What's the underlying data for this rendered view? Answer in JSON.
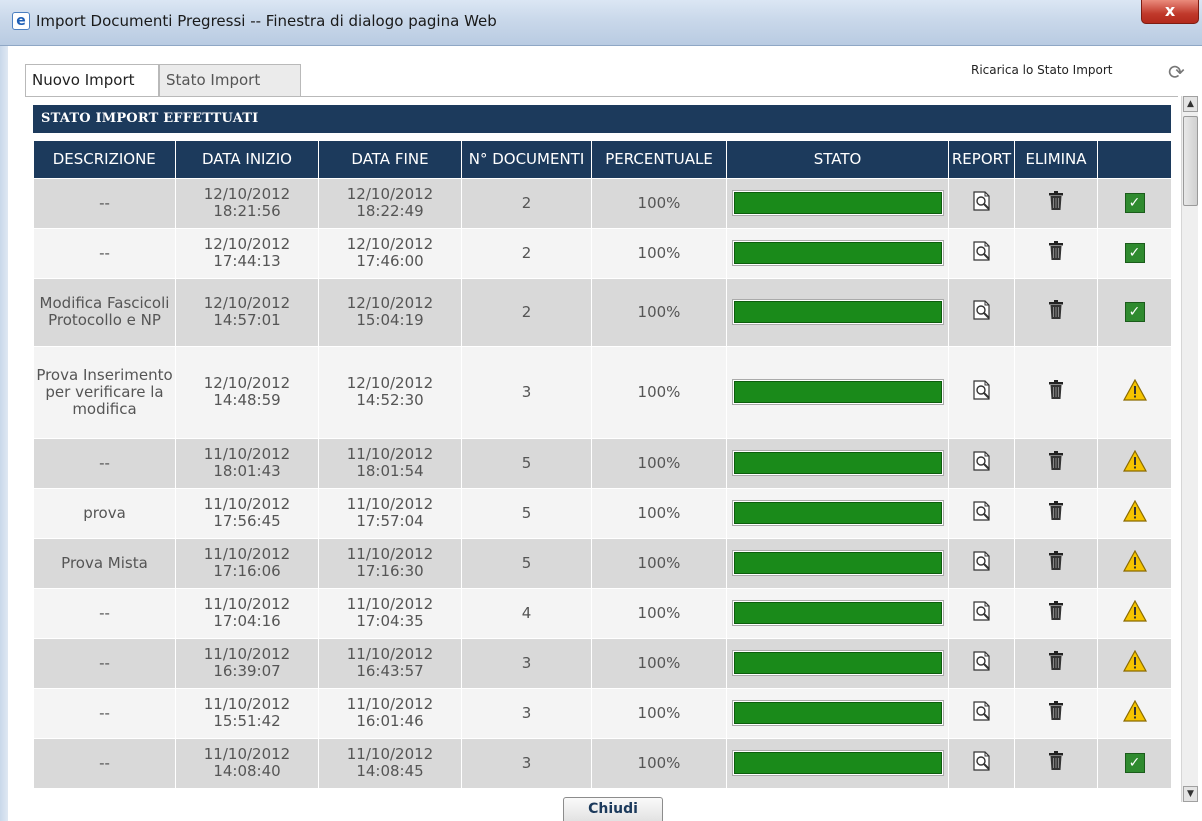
{
  "window": {
    "title": "Import Documenti Pregressi -- Finestra di dialogo pagina Web",
    "close_glyph": "x"
  },
  "tabs": [
    {
      "label": "Nuovo Import",
      "active": true
    },
    {
      "label": "Stato Import",
      "active": false
    }
  ],
  "toolbar": {
    "reload_label": "Ricarica lo Stato Import",
    "reload_icon": "refresh-icon"
  },
  "section": {
    "title": "STATO IMPORT EFFETTUATI"
  },
  "table": {
    "columns": [
      "DESCRIZIONE",
      "DATA INIZIO",
      "DATA FINE",
      "N° DOCUMENTI",
      "PERCENTUALE",
      "STATO",
      "REPORT",
      "ELIMINA",
      ""
    ],
    "rows": [
      {
        "descrizione": "--",
        "inizio_data": "12/10/2012",
        "inizio_ora": "18:21:56",
        "fine_data": "12/10/2012",
        "fine_ora": "18:22:49",
        "documenti": "2",
        "percentuale": "100%",
        "progress": 1.0,
        "esito": "ok"
      },
      {
        "descrizione": "--",
        "inizio_data": "12/10/2012",
        "inizio_ora": "17:44:13",
        "fine_data": "12/10/2012",
        "fine_ora": "17:46:00",
        "documenti": "2",
        "percentuale": "100%",
        "progress": 1.0,
        "esito": "ok"
      },
      {
        "descrizione": "Modifica Fascicoli Protocollo e NP",
        "inizio_data": "12/10/2012",
        "inizio_ora": "14:57:01",
        "fine_data": "12/10/2012",
        "fine_ora": "15:04:19",
        "documenti": "2",
        "percentuale": "100%",
        "progress": 1.0,
        "esito": "ok"
      },
      {
        "descrizione": "Prova Inserimento per verificare la modifica",
        "inizio_data": "12/10/2012",
        "inizio_ora": "14:48:59",
        "fine_data": "12/10/2012",
        "fine_ora": "14:52:30",
        "documenti": "3",
        "percentuale": "100%",
        "progress": 1.0,
        "esito": "warning"
      },
      {
        "descrizione": "--",
        "inizio_data": "11/10/2012",
        "inizio_ora": "18:01:43",
        "fine_data": "11/10/2012",
        "fine_ora": "18:01:54",
        "documenti": "5",
        "percentuale": "100%",
        "progress": 1.0,
        "esito": "warning"
      },
      {
        "descrizione": "prova",
        "inizio_data": "11/10/2012",
        "inizio_ora": "17:56:45",
        "fine_data": "11/10/2012",
        "fine_ora": "17:57:04",
        "documenti": "5",
        "percentuale": "100%",
        "progress": 1.0,
        "esito": "warning"
      },
      {
        "descrizione": "Prova Mista",
        "inizio_data": "11/10/2012",
        "inizio_ora": "17:16:06",
        "fine_data": "11/10/2012",
        "fine_ora": "17:16:30",
        "documenti": "5",
        "percentuale": "100%",
        "progress": 1.0,
        "esito": "warning"
      },
      {
        "descrizione": "--",
        "inizio_data": "11/10/2012",
        "inizio_ora": "17:04:16",
        "fine_data": "11/10/2012",
        "fine_ora": "17:04:35",
        "documenti": "4",
        "percentuale": "100%",
        "progress": 1.0,
        "esito": "warning"
      },
      {
        "descrizione": "--",
        "inizio_data": "11/10/2012",
        "inizio_ora": "16:39:07",
        "fine_data": "11/10/2012",
        "fine_ora": "16:43:57",
        "documenti": "3",
        "percentuale": "100%",
        "progress": 1.0,
        "esito": "warning"
      },
      {
        "descrizione": "--",
        "inizio_data": "11/10/2012",
        "inizio_ora": "15:51:42",
        "fine_data": "11/10/2012",
        "fine_ora": "16:01:46",
        "documenti": "3",
        "percentuale": "100%",
        "progress": 1.0,
        "esito": "warning"
      },
      {
        "descrizione": "--",
        "inizio_data": "11/10/2012",
        "inizio_ora": "14:08:40",
        "fine_data": "11/10/2012",
        "fine_ora": "14:08:45",
        "documenti": "3",
        "percentuale": "100%",
        "progress": 1.0,
        "esito": "ok"
      }
    ]
  },
  "footer": {
    "close_label": "Chiudi"
  },
  "colors": {
    "header_bg": "#1c3a5c",
    "progress_fill": "#1a8a1a",
    "row_odd": "#d9d9d9",
    "row_even": "#f4f4f4"
  }
}
